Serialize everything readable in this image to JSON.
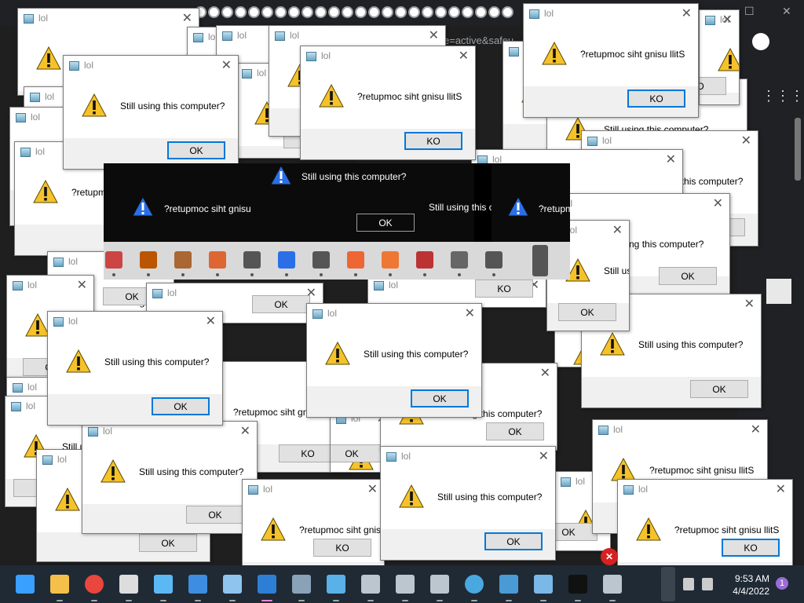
{
  "browser": {
    "address_fragment": "e=active&safeu",
    "window_controls": [
      "—",
      "☐",
      "✕"
    ]
  },
  "dialog": {
    "title": "lol",
    "close_glyph": "✕",
    "msg": "Still using this computer?",
    "msg_rev": "?retupmoc siht gnisu llitS",
    "ok": "OK",
    "ko": "KO"
  },
  "alttab": {
    "msg": "Still using this computer?",
    "msg_rev_partial": "?retupmoc siht gnisu l",
    "msg_partial_right": "Still using this comp",
    "msg_rev_right": "?retupmo",
    "ok": "OK"
  },
  "taskbar": {
    "time": "9:53 AM",
    "date": "4/4/2022",
    "notification_count": "1"
  },
  "colors": {
    "accent": "#0078d7",
    "taskbar_bg": "#1f2a35",
    "warning": "#f6c22a"
  },
  "icons": [
    "start-icon",
    "file-explorer-icon",
    "chrome-icon",
    "7zip-icon",
    "notepad-icon",
    "photos-icon",
    "paint-icon",
    "app-window-icon",
    "calculator-icon",
    "control-panel-icon",
    "network-icon",
    "network-icon",
    "network-icon",
    "globe-icon",
    "puzzle-icon",
    "task-manager-icon",
    "cmd-icon",
    "network-icon"
  ]
}
